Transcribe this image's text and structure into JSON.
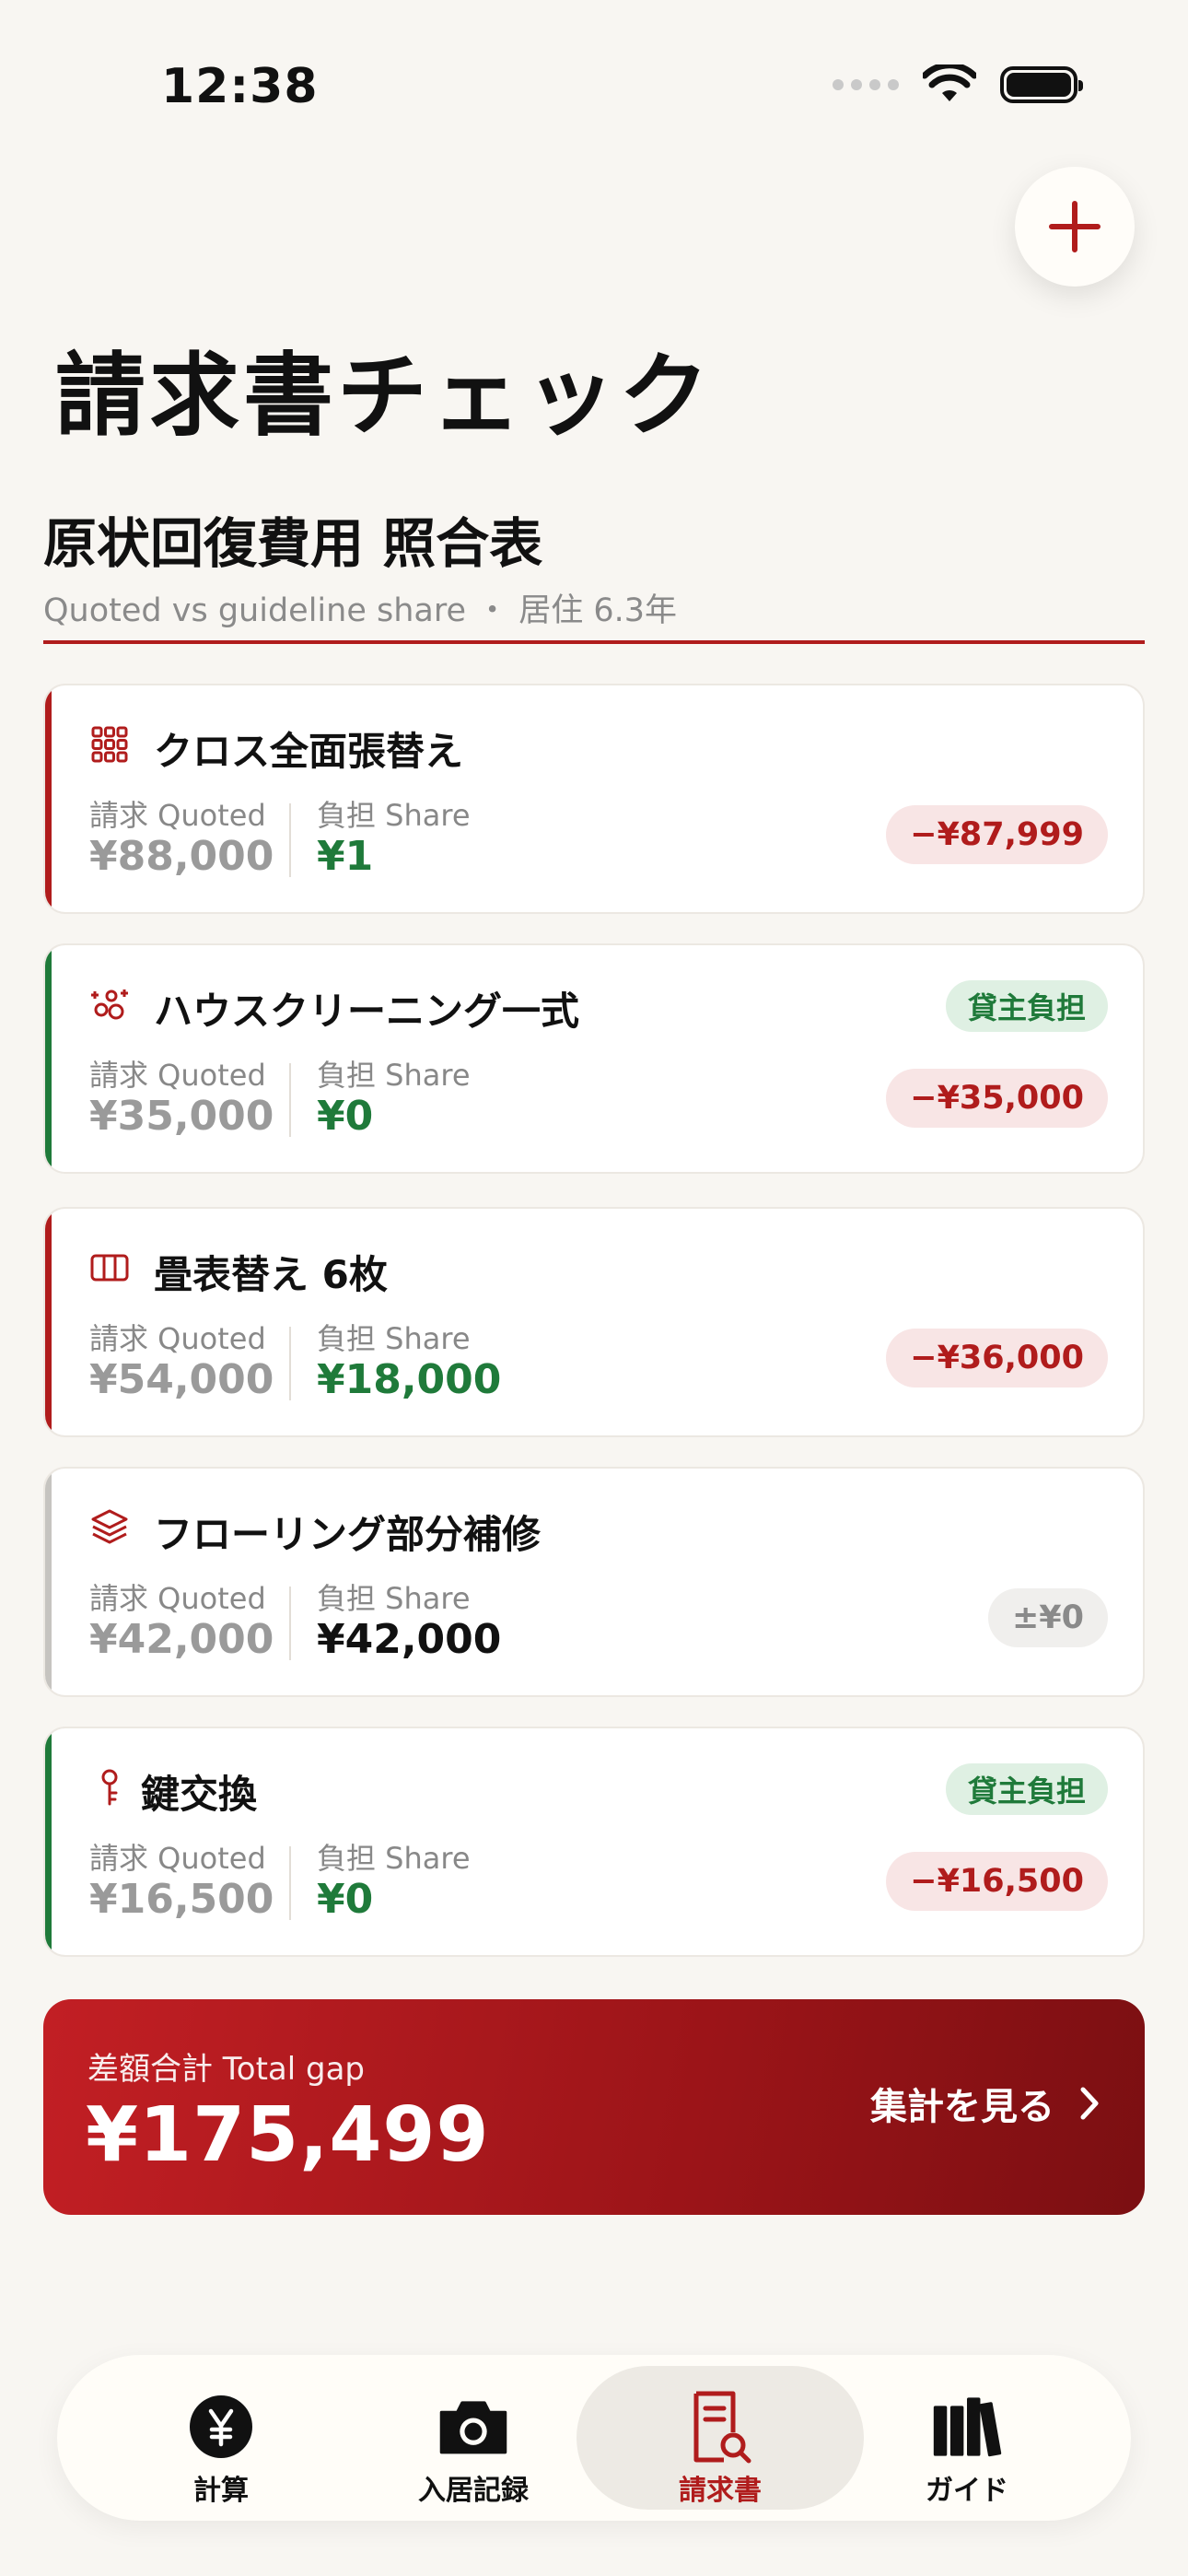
{
  "status": {
    "time": "12:38"
  },
  "page": {
    "title": "請求書チェック"
  },
  "section": {
    "title": "原状回復費用 照合表",
    "subtitle": "Quoted vs guideline share ・ 居住 6.3年"
  },
  "labels": {
    "quoted": "請求 Quoted",
    "share": "負担 Share"
  },
  "colors": {
    "accent": "#b01c1c",
    "green": "#1f7a3a",
    "gray": "#c6c4c0"
  },
  "items": [
    {
      "title": "クロス全面張替え",
      "icon": "grid-icon",
      "quoted": "¥88,000",
      "share": "¥1",
      "diff": "−¥87,999",
      "tenant_badge": "",
      "accent": "red"
    },
    {
      "title": "ハウスクリーニング一式",
      "icon": "sparkles-icon",
      "quoted": "¥35,000",
      "share": "¥0",
      "diff": "−¥35,000",
      "tenant_badge": "貸主負担",
      "accent": "green"
    },
    {
      "title": "畳表替え 6枚",
      "icon": "tatami-icon",
      "quoted": "¥54,000",
      "share": "¥18,000",
      "diff": "−¥36,000",
      "tenant_badge": "",
      "accent": "red"
    },
    {
      "title": "フローリング部分補修",
      "icon": "layers-icon",
      "quoted": "¥42,000",
      "share": "¥42,000",
      "diff": "±¥0",
      "tenant_badge": "",
      "accent": "gray"
    },
    {
      "title": "鍵交換",
      "icon": "key-icon",
      "quoted": "¥16,500",
      "share": "¥0",
      "diff": "−¥16,500",
      "tenant_badge": "貸主負担",
      "accent": "green"
    }
  ],
  "total": {
    "label": "差額合計 Total gap",
    "value": "¥175,499",
    "link": "集計を見る"
  },
  "tabs": [
    {
      "label": "計算",
      "icon": "yen-icon",
      "active": false
    },
    {
      "label": "入居記録",
      "icon": "camera-icon",
      "active": false
    },
    {
      "label": "請求書",
      "icon": "invoice-search-icon",
      "active": true
    },
    {
      "label": "ガイド",
      "icon": "books-icon",
      "active": false
    }
  ]
}
